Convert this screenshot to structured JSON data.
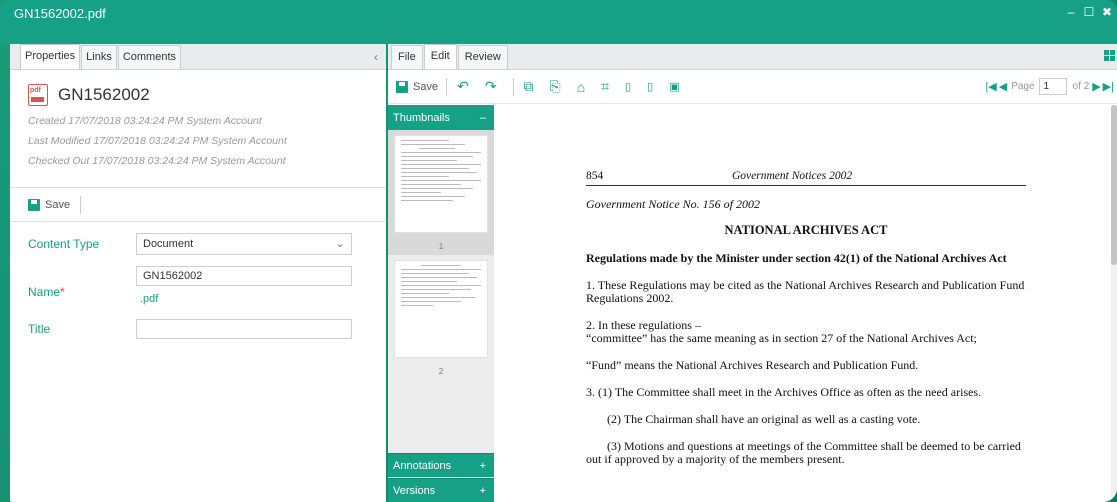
{
  "window": {
    "title": "GN1562002.pdf",
    "controls": [
      "–",
      "☐",
      "✖"
    ]
  },
  "left_panel": {
    "tabs": [
      "Properties",
      "Links",
      "Comments"
    ],
    "collapse_icon": "‹",
    "doc_title": "GN1562002",
    "pdf_icon_label": "pdf",
    "meta": [
      "Created 17/07/2018 03:24:24 PM System Account",
      "Last Modified 17/07/2018 03:24:24 PM System Account",
      "Checked Out 17/07/2018 03:24:24 PM System Account"
    ],
    "save_label": "Save",
    "fields": {
      "content_type_label": "Content Type",
      "content_type_value": "Document",
      "name_label": "Name",
      "name_required": "*",
      "name_value": "GN1562002",
      "name_ext": ".pdf",
      "title_label": "Title",
      "title_value": ""
    }
  },
  "viewer": {
    "tabs": [
      "File",
      "Edit",
      "Review"
    ],
    "active_tab": "Edit",
    "toolbar_save": "Save",
    "pager": {
      "page_label": "Page",
      "current": "1",
      "of_label": "of 2"
    },
    "thumbnails_label": "Thumbnails",
    "thumb_collapse": "–",
    "thumb_pages": [
      "1",
      "2"
    ],
    "annotations_label": "Annotations",
    "versions_label": "Versions",
    "plus": "+",
    "document": {
      "page_no": "854",
      "publication": "Government Notices 2002",
      "notice": "Government Notice No. 156 of 2002",
      "act_title": "NATIONAL ARCHIVES ACT",
      "regs_title": "Regulations made by the Minister under section 42(1) of the National Archives Act",
      "para1": "1.  These Regulations may be cited as the National Archives Research and Publication Fund Regulations 2002.",
      "para2a": "2.  In these regulations –",
      "para2b": "“committee” has the same meaning as in section 27 of the National Archives Act;",
      "para_fund": "“Fund” means the National Archives Research and Publication Fund.",
      "para3_1": "3.  (1) The Committee shall meet in the Archives Office as often as the need arises.",
      "para3_2": "(2) The Chairman shall have an original as well as a casting vote.",
      "para3_3": "(3) Motions and questions at meetings of the Committee shall be deemed to be carried out if approved by a majority of the members present."
    }
  },
  "colors": {
    "accent": "#16a085",
    "required": "#e74c3c",
    "meta_text": "#9a9a9a"
  }
}
